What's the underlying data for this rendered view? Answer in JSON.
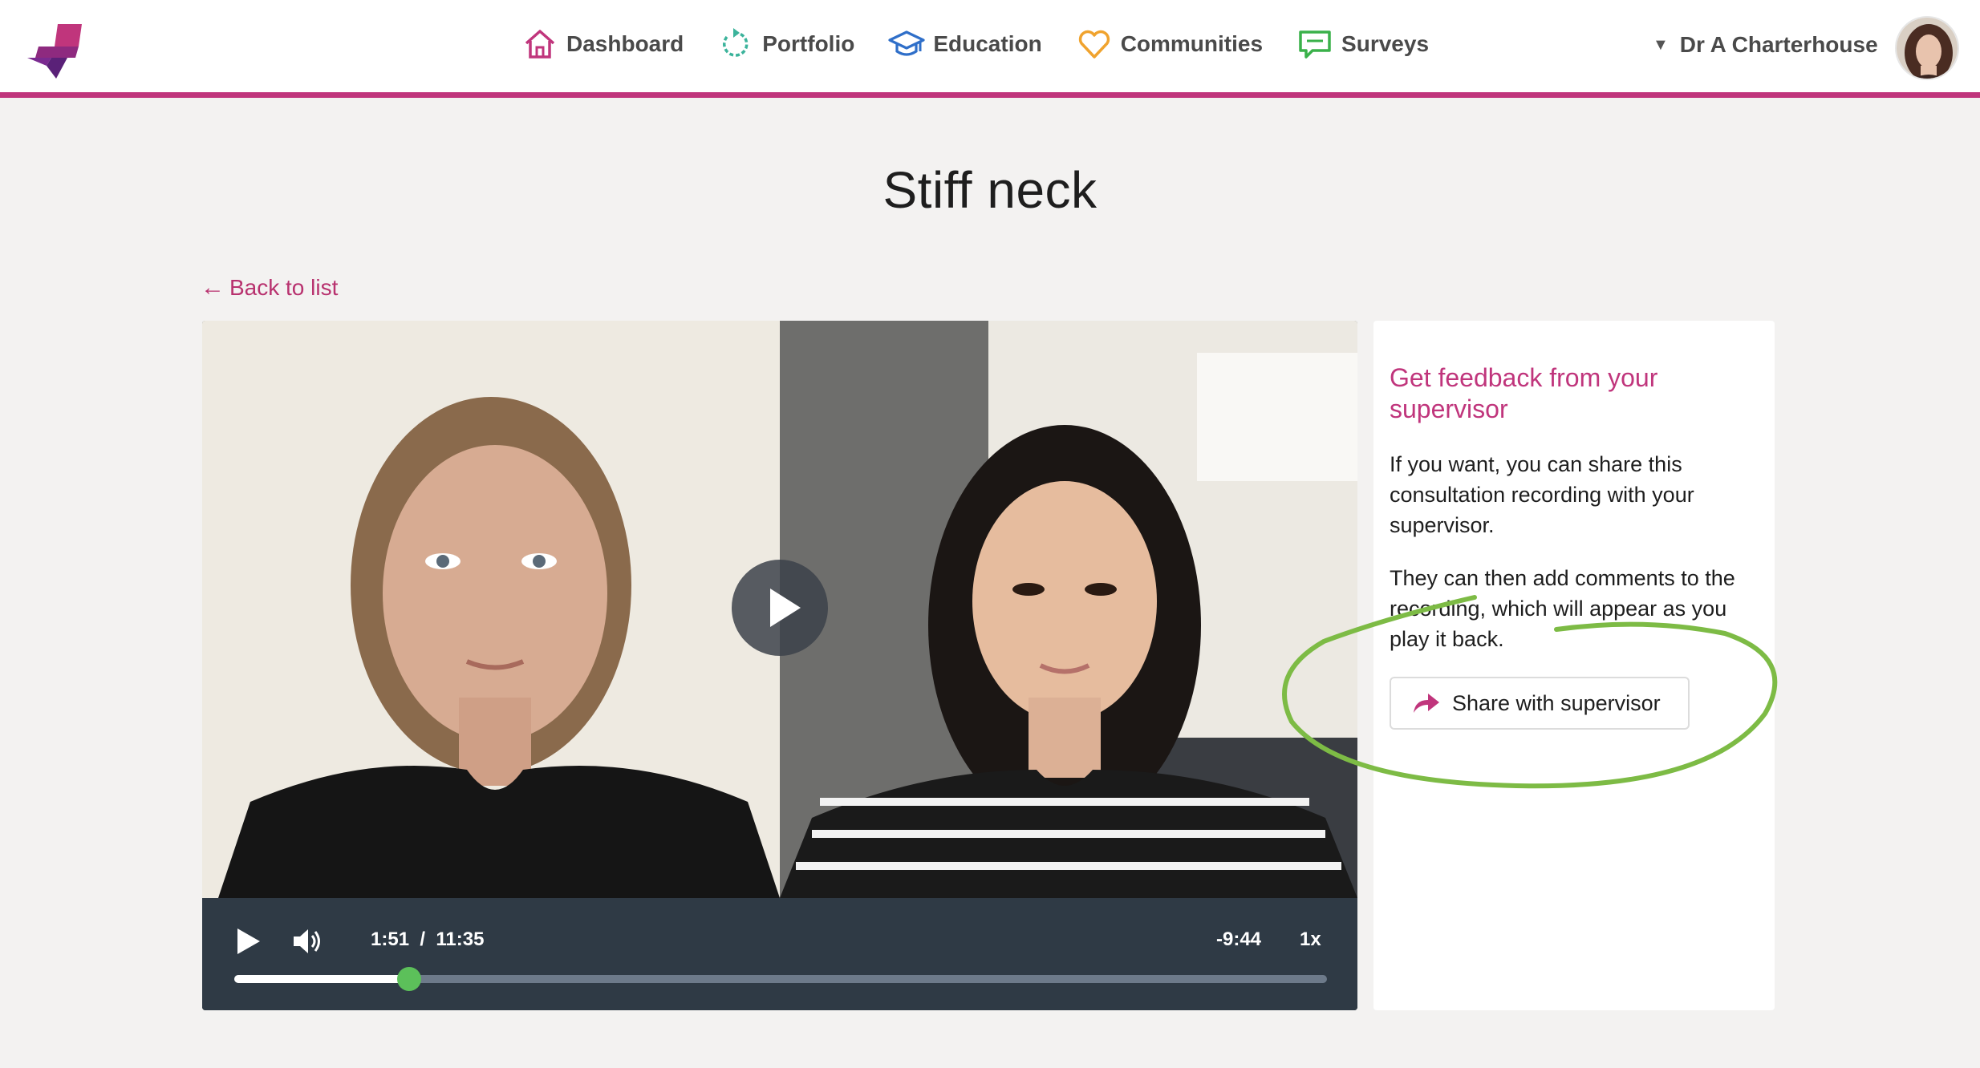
{
  "header": {
    "nav": [
      {
        "label": "Dashboard",
        "icon": "home-icon",
        "color": "#c0357c"
      },
      {
        "label": "Portfolio",
        "icon": "refresh-icon",
        "color": "#3bb39b"
      },
      {
        "label": "Education",
        "icon": "graduation-cap-icon",
        "color": "#2f6fc9"
      },
      {
        "label": "Communities",
        "icon": "heart-icon",
        "color": "#f0a32e"
      },
      {
        "label": "Surveys",
        "icon": "chat-icon",
        "color": "#3ab14a"
      }
    ],
    "user_name": "Dr A Charterhouse",
    "accent": "#c0357c"
  },
  "page": {
    "title": "Stiff neck",
    "back_label": "Back to list"
  },
  "player": {
    "current_time": "1:51",
    "separator": "/",
    "duration": "11:35",
    "remaining": "-9:44",
    "speed": "1x",
    "progress": 0.16
  },
  "panel": {
    "title": "Get feedback from your supervisor",
    "paragraph1": "If you want, you can share this consultation recording with your supervisor.",
    "paragraph2": "They can then add comments to the recording, which will appear as you play it back.",
    "share_label": "Share with supervisor"
  }
}
